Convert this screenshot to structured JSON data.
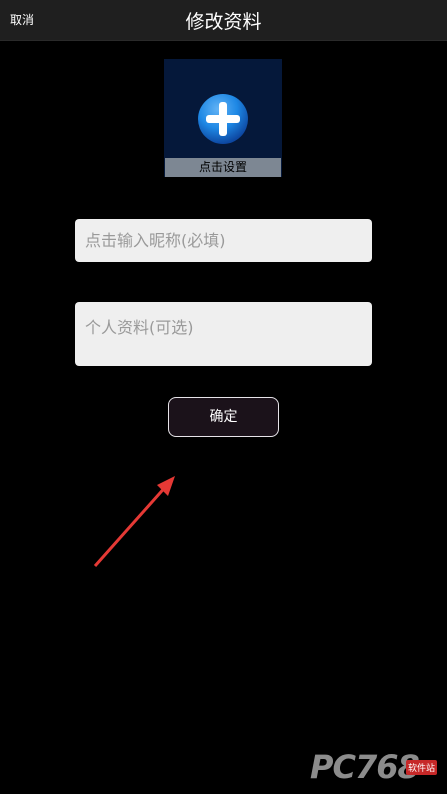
{
  "header": {
    "cancel_label": "取消",
    "title": "修改资料"
  },
  "avatar": {
    "icon": "plus-circle-icon",
    "caption": "点击设置"
  },
  "form": {
    "nickname_placeholder": "点击输入昵称(必填)",
    "profile_placeholder": "个人资料(可选)",
    "confirm_label": "确定"
  },
  "annotation": {
    "arrow_color": "#e53935"
  },
  "watermark": {
    "logo_text": "PC768",
    "tag": "软件站"
  },
  "colors": {
    "background": "#000000",
    "topbar": "#1f1f1f",
    "avatar_bg": "#05183a",
    "plus_blue": "#1e88e5",
    "input_bg": "#efefef"
  }
}
